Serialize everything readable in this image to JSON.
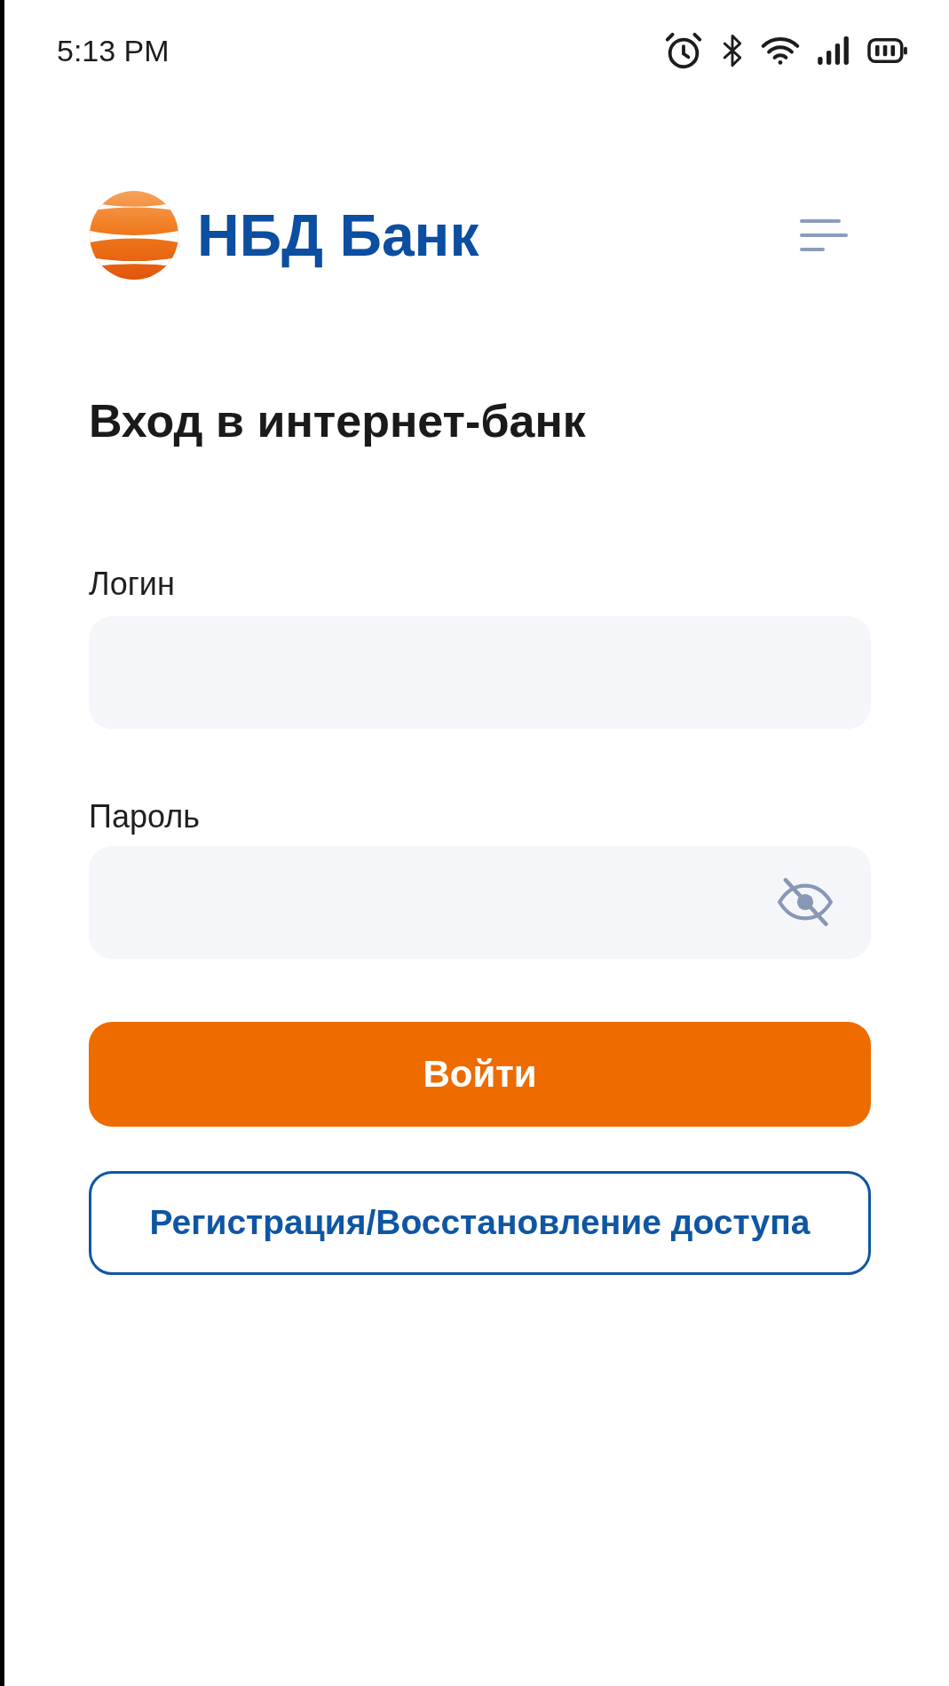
{
  "status_bar": {
    "time": "5:13 PM"
  },
  "header": {
    "logo_text": "НБД Банк"
  },
  "title": "Вход в интернет-банк",
  "form": {
    "fields": [
      {
        "label": "Логин",
        "kind": "text"
      },
      {
        "label": "Пароль",
        "kind": "password",
        "password_hidden": true
      }
    ]
  },
  "buttons": [
    {
      "label": "Войти",
      "kind": "primary"
    },
    {
      "label": "Регистрация/Восстановление доступа",
      "kind": "outline"
    }
  ]
}
